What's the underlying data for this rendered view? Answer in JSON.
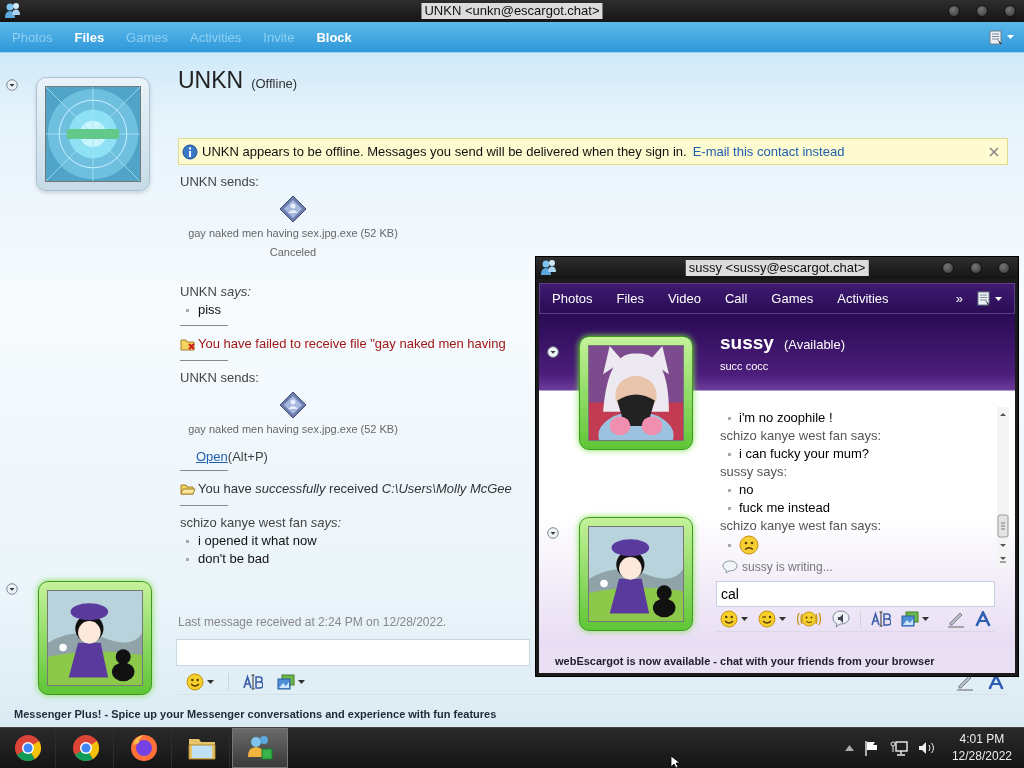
{
  "back_window": {
    "title": "UNKN <unkn@escargot.chat>",
    "toolbar": [
      {
        "label": "Photos",
        "disabled": true
      },
      {
        "label": "Files",
        "disabled": false
      },
      {
        "label": "Games",
        "disabled": true
      },
      {
        "label": "Activities",
        "disabled": true
      },
      {
        "label": "Invite",
        "disabled": true
      },
      {
        "label": "Block",
        "disabled": false
      }
    ],
    "contact": {
      "name": "UNKN",
      "status": "(Offline)"
    },
    "info_bar": {
      "text": "UNKN appears to be offline. Messages you send will be delivered when they sign in.",
      "link": "E-mail this contact instead"
    },
    "messages": [
      {
        "kind": "file",
        "header": "UNKN sends:",
        "file": "gay naked men having sex.jpg.exe (52 KB)",
        "status": "Canceled",
        "divider": false
      },
      {
        "kind": "say",
        "sender": "UNKN *says:*",
        "lines": [
          "piss"
        ],
        "divider": true
      },
      {
        "kind": "failed",
        "text": "You have failed to receive file \"gay naked men having",
        "divider": true
      },
      {
        "kind": "file",
        "header": "UNKN sends:",
        "file": "gay naked men having sex.jpg.exe (52 KB)",
        "link": "Open",
        "hint": "(Alt+P)",
        "divider": true
      },
      {
        "kind": "received",
        "text": "You have *successfully* received *C:\\Users\\Molly McGee*",
        "divider": true
      },
      {
        "kind": "say",
        "sender": "schizo kanye west fan *says:*",
        "lines": [
          "i opened it what now",
          "don't be bad"
        ],
        "divider": false
      }
    ],
    "last_message": "Last message received at 2:24 PM on 12/28/2022.",
    "status_bar": "Messenger Plus! - Spice up your Messenger conversations and experience with fun features"
  },
  "front_window": {
    "title": "sussy <sussy@escargot.chat>",
    "toolbar": [
      "Photos",
      "Files",
      "Video",
      "Call",
      "Games",
      "Activities"
    ],
    "overflow": "»",
    "contact": {
      "name": "sussy",
      "status": "(Available)",
      "personal_message": "succ cocc"
    },
    "messages": [
      {
        "kind": "line",
        "text": "i'm no zoophile !"
      },
      {
        "kind": "sender",
        "text": "schizo kanye west fan says:"
      },
      {
        "kind": "line",
        "text": "i can fucky your mum?"
      },
      {
        "kind": "sender",
        "text": "sussy says:"
      },
      {
        "kind": "line",
        "text": "no"
      },
      {
        "kind": "line",
        "text": "fuck me instead"
      },
      {
        "kind": "sender",
        "text": "schizo kanye west fan says:"
      },
      {
        "kind": "emoticon"
      }
    ],
    "typing": "sussy is writing...",
    "input": {
      "value": "cal"
    },
    "banner": "webEscargot is now available - chat with your friends from your browser"
  },
  "taskbar": {
    "apps": [
      {
        "kind": "browser",
        "active": false
      },
      {
        "kind": "browser",
        "active": false
      },
      {
        "kind": "fox",
        "active": false
      },
      {
        "kind": "folder",
        "active": false
      },
      {
        "kind": "messenger",
        "active": true
      }
    ],
    "clock": {
      "time": "4:01 PM",
      "date": "12/28/2022"
    }
  }
}
